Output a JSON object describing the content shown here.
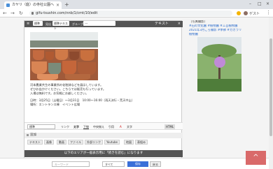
{
  "browser": {
    "tab_title": "カヤリ（庭）の寺社公園へ",
    "url": "gifu-tsushin.com/nnb/1/cmt/10/edit",
    "new_tab": "+",
    "minimize": "–",
    "maximize": "□",
    "close": "×",
    "profile_label": "ゲスト"
  },
  "editor": {
    "bar_label": "テキスト",
    "font_label": "標準",
    "size_select": "標準テキスト",
    "group_label": "グループ",
    "group_select": "---",
    "close_label": "×",
    "body_lines": [
      "河本農業共生の事業所の化粧鉢などを展示しています。",
      "ぜひお出かけください。こちらでは販売も行っています。",
      "入場は無料です。お気軽にお越しください。"
    ],
    "detail_lines": [
      "日時：3月25日（土曜日）～3月31日　10:00～16:00（雨天決行・荒天中止）",
      "場所：エントランス棟　イベント広場"
    ],
    "format_select": "標準",
    "format_buttons": [
      "リンク",
      "太字",
      "下線",
      "中央揃え",
      "引用",
      "A",
      "文字"
    ],
    "html_label": "HTML",
    "add_label": "追加",
    "chips": [
      "テキスト",
      "画像",
      "動画",
      "ファイル",
      "外部リンク",
      "Youtube",
      "地図",
      "表組み"
    ],
    "notice": "以下のエリアが一般表示用に「続きを読む」になります"
  },
  "footer": {
    "input_placeholder": "キーワード",
    "select_value": "すべて",
    "primary_button": "保存",
    "secondary_button": "戻る"
  },
  "sidebar": {
    "lines": [
      "（写真撮影）",
      "#石の文化園 #植物園 #工芸植物園",
      "2021年3月ごろ撮影 #季節 #カカラリ",
      "植物園"
    ]
  },
  "to_top": "^"
}
